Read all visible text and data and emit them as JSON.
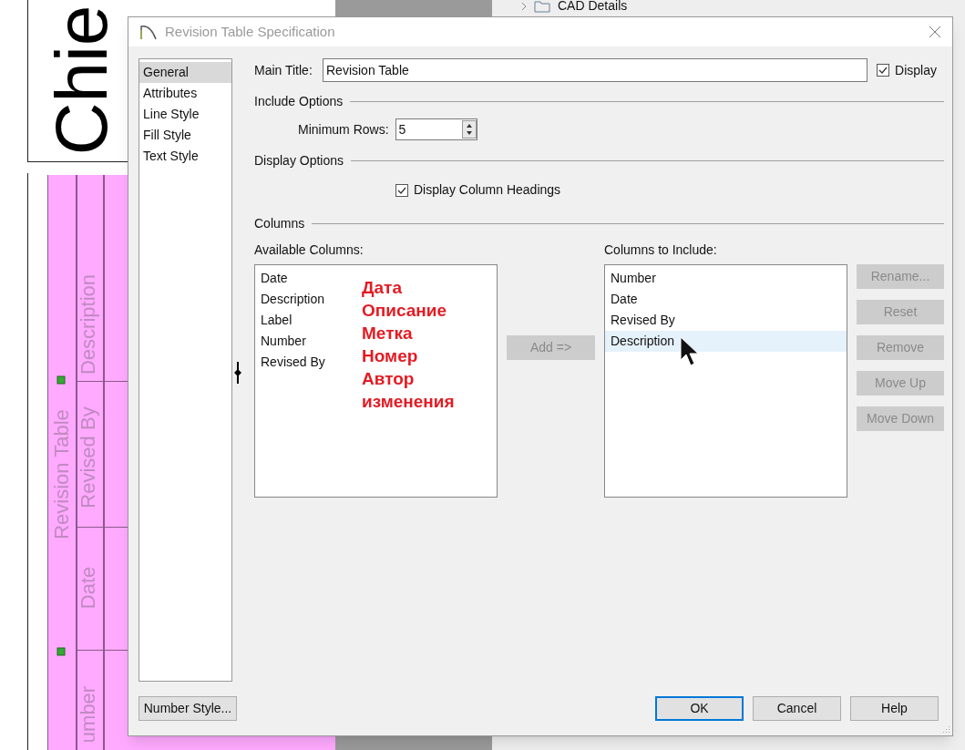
{
  "canvas": {
    "logo_text": "Chie",
    "tree_item": {
      "label": "CAD Details"
    },
    "revision_table": {
      "title": "Revision Table",
      "headings": [
        "Description",
        "Revised By",
        "Date",
        "umber"
      ]
    }
  },
  "dialog": {
    "title": "Revision Table Specification",
    "nav": [
      {
        "label": "General",
        "selected": true
      },
      {
        "label": "Attributes",
        "selected": false
      },
      {
        "label": "Line Style",
        "selected": false
      },
      {
        "label": "Fill Style",
        "selected": false
      },
      {
        "label": "Text Style",
        "selected": false
      }
    ],
    "number_style_button": "Number Style...",
    "main_title": {
      "label": "Main Title:",
      "value": "Revision Table"
    },
    "display": {
      "label": "Display",
      "checked": true
    },
    "include_options": {
      "heading": "Include Options",
      "min_rows": {
        "label": "Minimum Rows:",
        "value": "5"
      }
    },
    "display_options": {
      "heading": "Display Options",
      "column_headings": {
        "label": "Display Column Headings",
        "checked": true
      }
    },
    "columns": {
      "heading": "Columns",
      "available": {
        "label": "Available Columns:",
        "items": [
          "Date",
          "Description",
          "Label",
          "Number",
          "Revised By"
        ]
      },
      "add_button": {
        "label": "Add =>",
        "disabled": true
      },
      "included": {
        "label": "Columns to Include:",
        "items": [
          {
            "label": "Number",
            "selected": false
          },
          {
            "label": "Date",
            "selected": false
          },
          {
            "label": "Revised By",
            "selected": false
          },
          {
            "label": "Description",
            "selected": true
          }
        ]
      },
      "side_buttons": [
        {
          "label": "Rename...",
          "disabled": true
        },
        {
          "label": "Reset",
          "disabled": true
        },
        {
          "label": "Remove",
          "disabled": true
        },
        {
          "label": "Move Up",
          "disabled": true
        },
        {
          "label": "Move Down",
          "disabled": true
        }
      ]
    },
    "footer_buttons": [
      {
        "label": "OK",
        "default": true
      },
      {
        "label": "Cancel",
        "default": false
      },
      {
        "label": "Help",
        "default": false
      }
    ]
  },
  "annotations": [
    "Дата",
    "Описание",
    "Метка",
    "Номер",
    "Автор изменения"
  ]
}
